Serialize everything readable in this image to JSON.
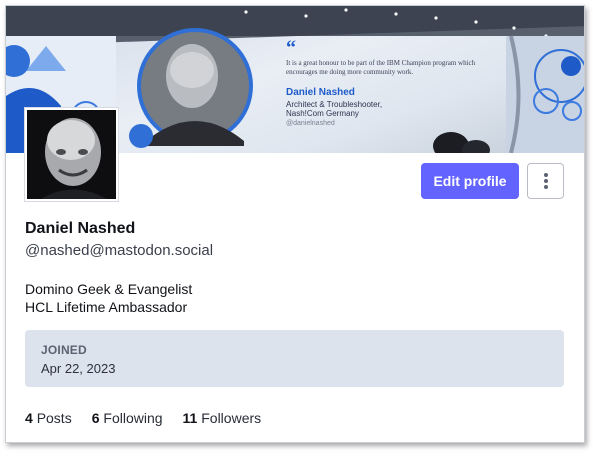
{
  "banner": {
    "quote_mark": "“",
    "quote_text": "It is a great honour to be part of the IBM Champion program which encourages me doing more community work.",
    "speaker_name": "Daniel Nashed",
    "speaker_title_1": "Architect & Troubleshooter,",
    "speaker_title_2": "Nash!Com Germany",
    "speaker_handle": "@danielnashed"
  },
  "profile": {
    "display_name": "Daniel Nashed",
    "handle": "@nashed@mastodon.social",
    "bio_line_1": "Domino Geek & Evangelist",
    "bio_line_2": "HCL Lifetime Ambassador"
  },
  "actions": {
    "edit_label": "Edit profile",
    "more_icon": "kebab-vertical-icon"
  },
  "joined": {
    "label": "JOINED",
    "date": "Apr 22, 2023"
  },
  "stats": {
    "posts_count": "4",
    "posts_label": "Posts",
    "following_count": "6",
    "following_label": "Following",
    "followers_count": "11",
    "followers_label": "Followers"
  },
  "colors": {
    "accent": "#6364ff",
    "joined_bg": "#dde3ec"
  }
}
